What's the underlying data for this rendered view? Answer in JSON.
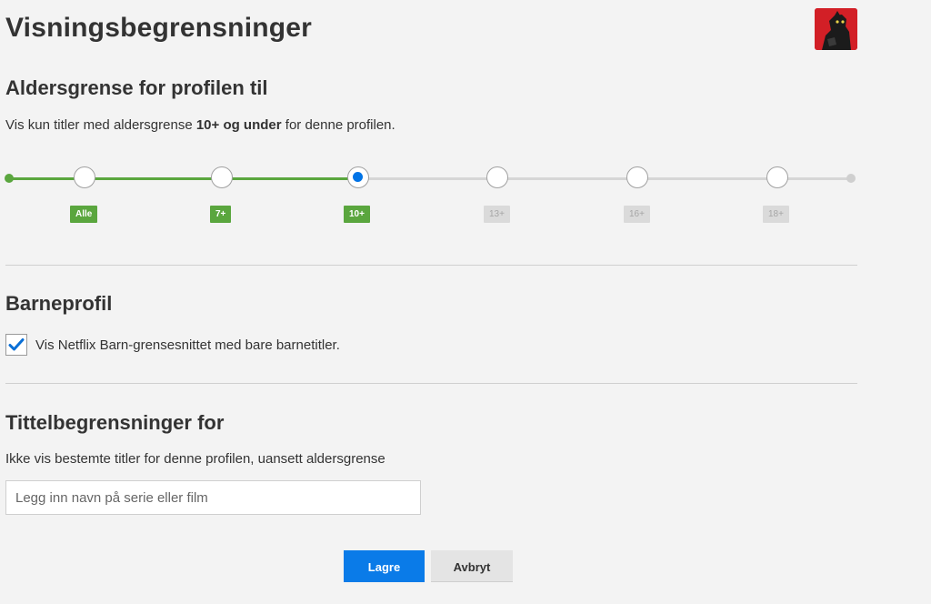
{
  "page": {
    "title": "Visningsbegrensninger"
  },
  "age_section": {
    "heading": "Aldersgrense for profilen til",
    "desc_prefix": "Vis kun titler med aldersgrense ",
    "desc_bold": "10+ og under",
    "desc_suffix": " for denne profilen.",
    "levels": [
      "Alle",
      "7+",
      "10+",
      "13+",
      "16+",
      "18+"
    ],
    "selected_level": "10+",
    "colors": {
      "active": "#5aa63e",
      "inactive": "#d6d6d6",
      "selected_dot": "#0073e6"
    }
  },
  "kids_section": {
    "heading": "Barneprofil",
    "checkbox_label": "Vis Netflix Barn-grensesnittet med bare barnetitler.",
    "checked": true
  },
  "title_section": {
    "heading": "Tittelbegrensninger for",
    "desc": "Ikke vis bestemte titler for denne profilen, uansett aldersgrense",
    "input_placeholder": "Legg inn navn på serie eller film",
    "input_value": ""
  },
  "actions": {
    "save_label": "Lagre",
    "cancel_label": "Avbryt"
  },
  "colors": {
    "primary": "#0a7be8",
    "avatar_bg": "#d21f26"
  }
}
